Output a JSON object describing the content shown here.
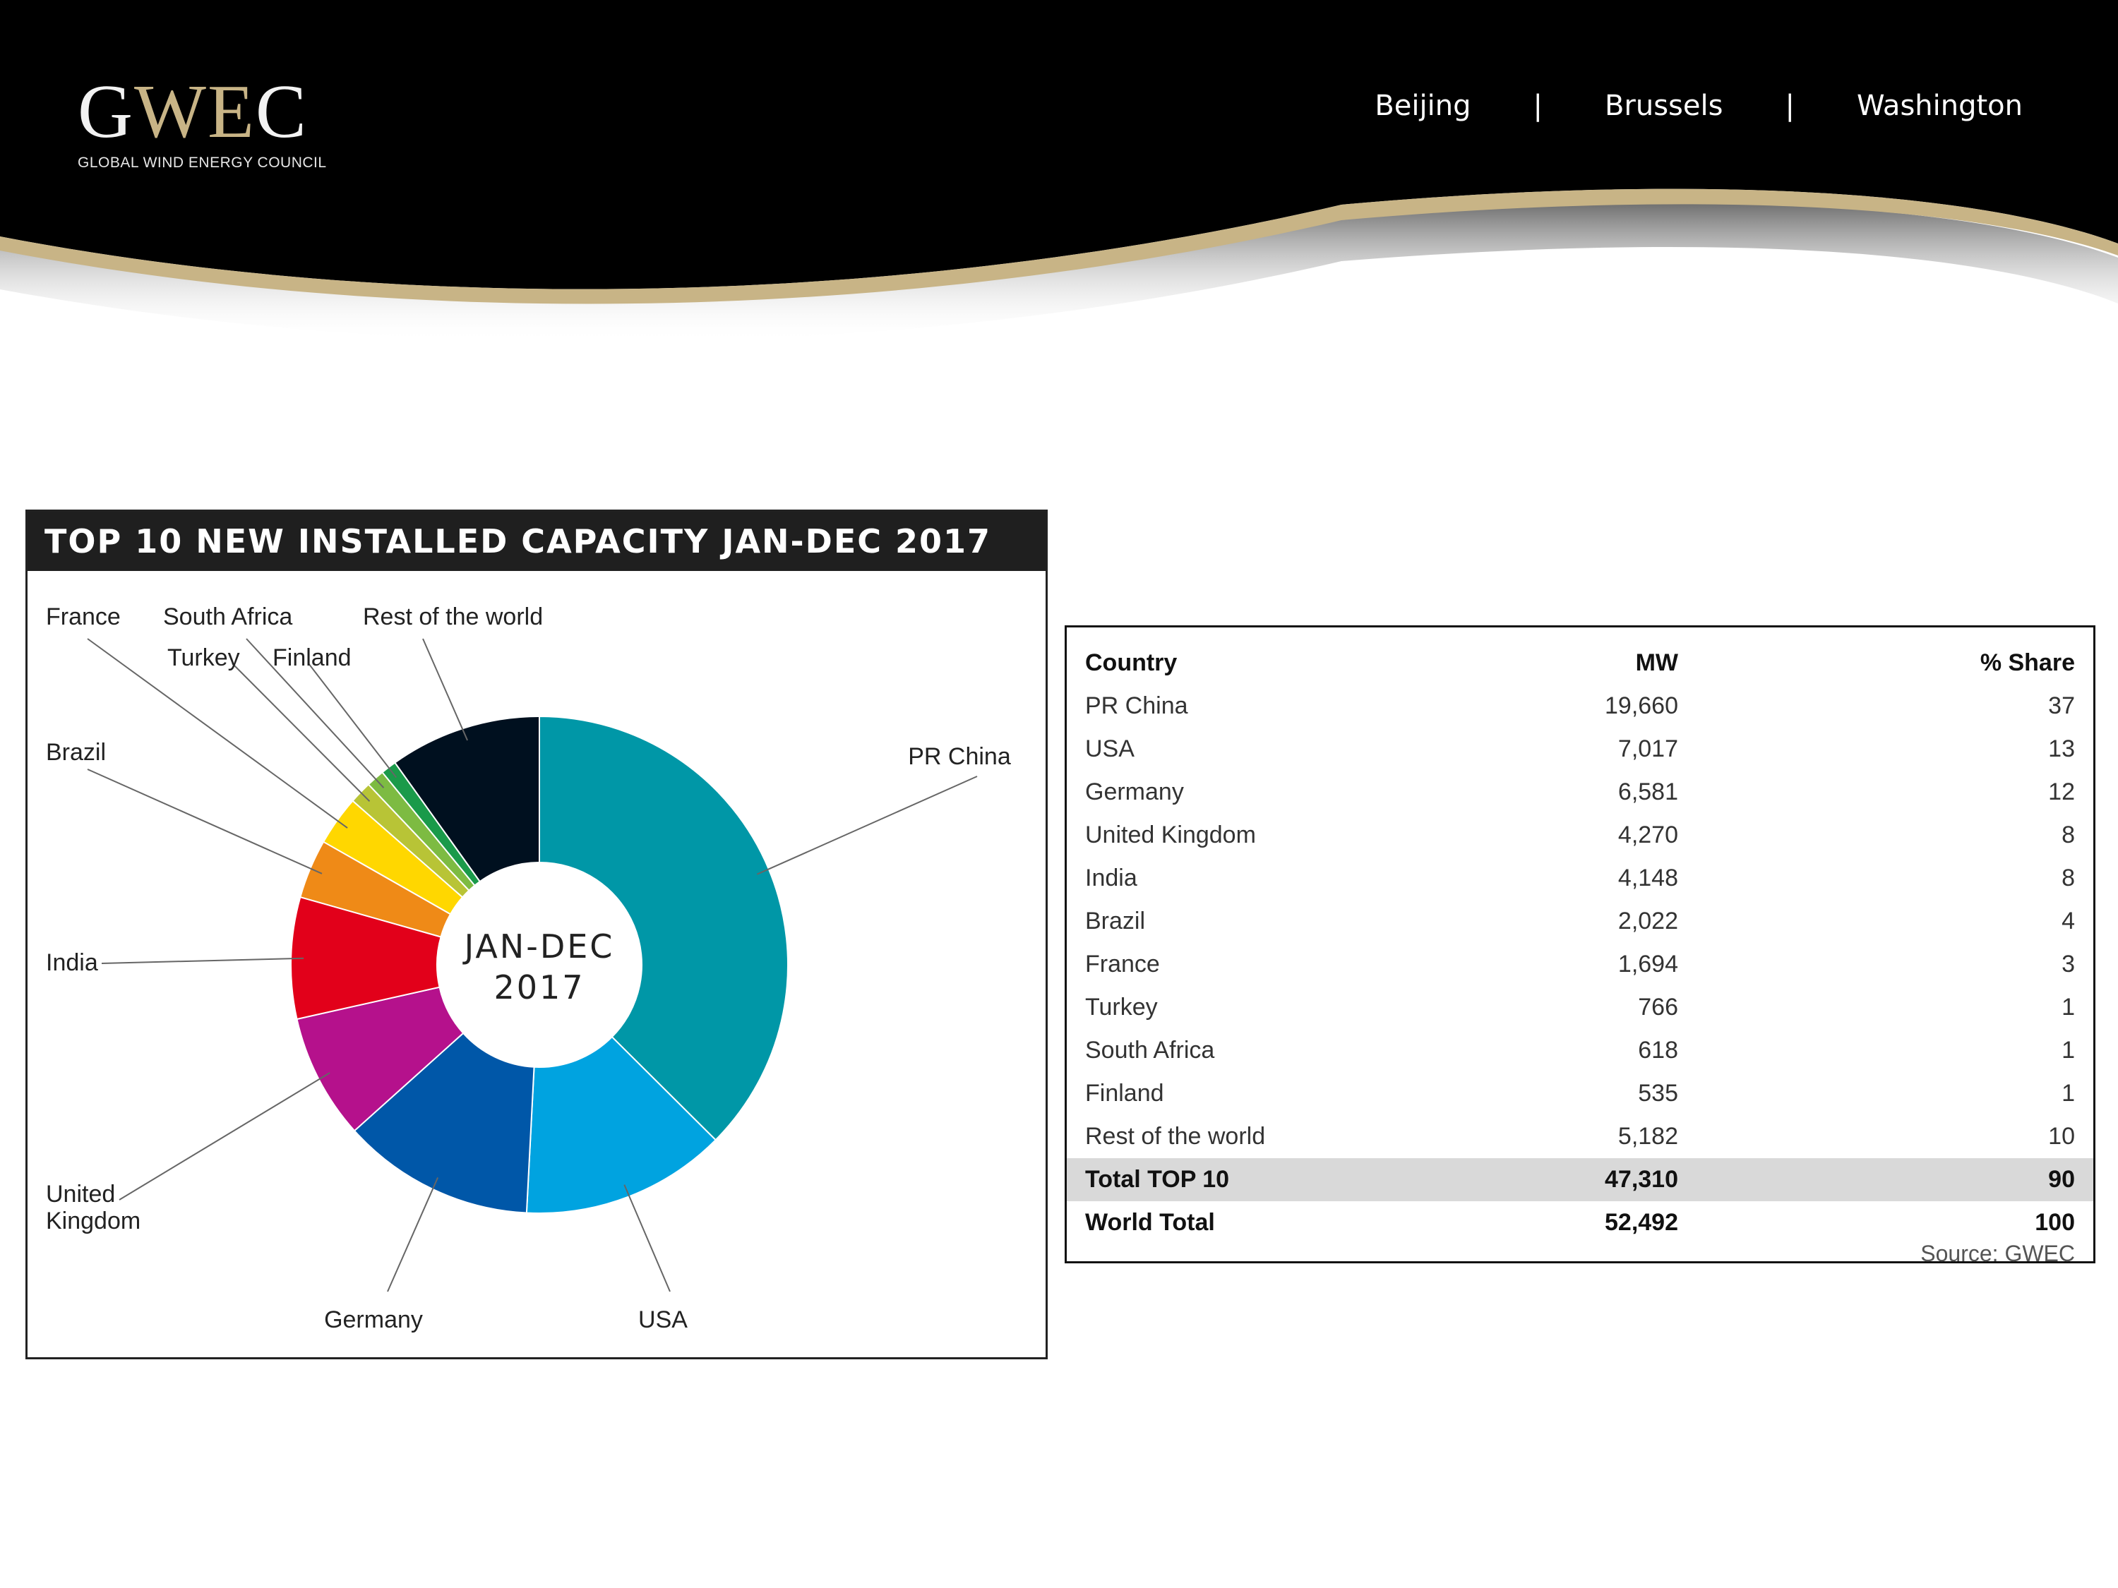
{
  "header": {
    "logo_main": "GWEC",
    "logo_sub": "GLOBAL WIND ENERGY COUNCIL",
    "nav": [
      "Beijing",
      "Brussels",
      "Washington"
    ],
    "nav_separator": "|",
    "colors": {
      "background": "#000000",
      "gold_band": "#c8b486"
    }
  },
  "chart_data": {
    "type": "pie",
    "title": "TOP 10 NEW INSTALLED CAPACITY JAN-DEC 2017",
    "center_label": [
      "JAN-DEC",
      "2017"
    ],
    "categories": [
      "PR China",
      "USA",
      "Germany",
      "United Kingdom",
      "India",
      "Brazil",
      "France",
      "Turkey",
      "South Africa",
      "Finland",
      "Rest of the world"
    ],
    "values": [
      19660,
      7017,
      6581,
      4270,
      4148,
      2022,
      1694,
      766,
      618,
      535,
      5182
    ],
    "colors": [
      "#0097a7",
      "#00a3e0",
      "#0057a8",
      "#b5118c",
      "#e2001a",
      "#ef8a17",
      "#ffd700",
      "#b8c436",
      "#7dbb42",
      "#1a9a4a",
      "#00101f"
    ]
  },
  "table": {
    "headers": [
      "Country",
      "MW",
      "% Share"
    ],
    "rows": [
      [
        "PR China",
        "19,660",
        "37"
      ],
      [
        "USA",
        "7,017",
        "13"
      ],
      [
        "Germany",
        "6,581",
        "12"
      ],
      [
        "United Kingdom",
        "4,270",
        "8"
      ],
      [
        "India",
        "4,148",
        "8"
      ],
      [
        "Brazil",
        "2,022",
        "4"
      ],
      [
        "France",
        "1,694",
        "3"
      ],
      [
        "Turkey",
        "766",
        "1"
      ],
      [
        "South Africa",
        "618",
        "1"
      ],
      [
        "Finland",
        "535",
        "1"
      ],
      [
        "Rest of the world",
        "5,182",
        "10"
      ]
    ],
    "total_top10": [
      "Total TOP 10",
      "47,310",
      "90"
    ],
    "world_total": [
      "World Total",
      "52,492",
      "100"
    ],
    "source": "Source: GWEC"
  }
}
